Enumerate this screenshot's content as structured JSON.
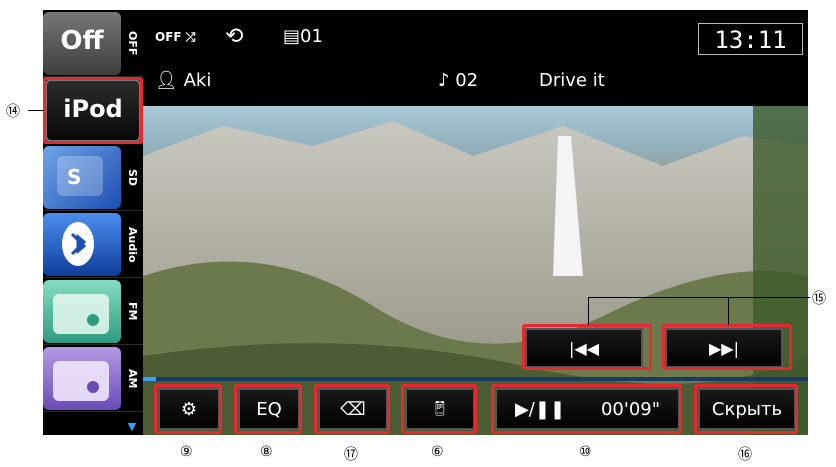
{
  "sources": [
    {
      "label": "OFF",
      "icon_text": "Off"
    },
    {
      "label": "",
      "icon_text": "iPod"
    },
    {
      "label": "SD",
      "icon_text": ""
    },
    {
      "label": "Audio",
      "icon_text": ""
    },
    {
      "label": "FM",
      "icon_text": ""
    },
    {
      "label": "AM",
      "icon_text": ""
    }
  ],
  "status": {
    "shuffle": "OFF",
    "episode": "01",
    "artist": "Aki",
    "track_number": "02",
    "song": "Drive it",
    "clock": "13:11"
  },
  "controls": {
    "eq": "EQ",
    "play_time": "00'09\"",
    "hide": "Скрыть"
  },
  "progress_fraction": 0.02,
  "callouts": {
    "ipod": "⑭",
    "skip": "⑮",
    "settings": "⑨",
    "eq": "⑧",
    "back": "⑰",
    "app": "⑥",
    "play": "⑩",
    "hide": "⑯"
  }
}
